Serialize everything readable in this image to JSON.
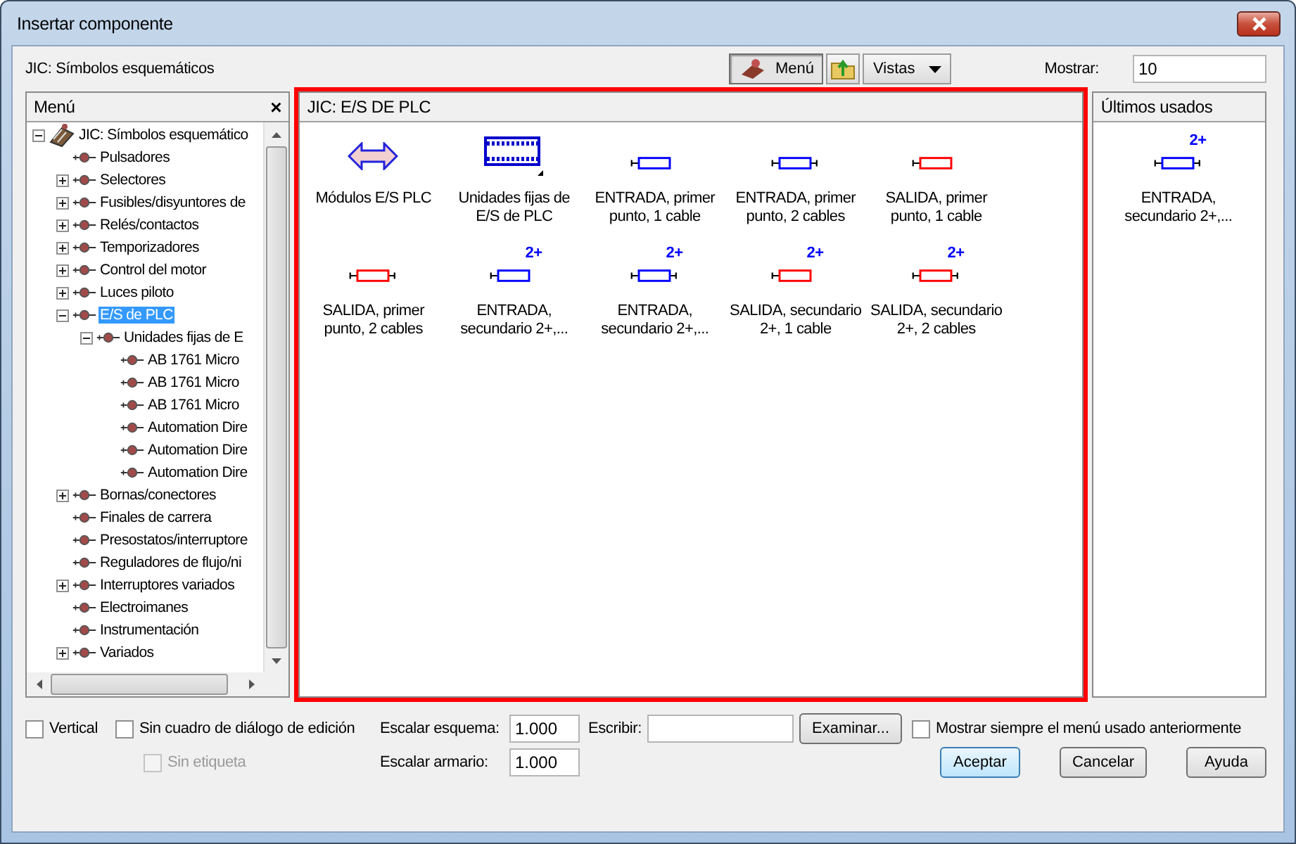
{
  "window": {
    "title": "Insertar componente"
  },
  "library_label": "JIC: Símbolos esquemáticos",
  "toolbar": [
    {
      "label": "Menú",
      "kind": "toggle",
      "pressed": true
    },
    {
      "kind": "folder-up"
    },
    {
      "label": "Vistas",
      "kind": "dropdown"
    }
  ],
  "show": {
    "label": "Mostrar:",
    "value": "10"
  },
  "menu_panel": {
    "title": "Menú",
    "close": "×",
    "tree": [
      {
        "label": "JIC: Símbolos esquemático",
        "kind": "library",
        "expanded": true,
        "selected": false,
        "children": [
          {
            "label": "Pulsadores",
            "selected": false
          },
          {
            "label": "Selectores",
            "expanded": false,
            "selected": false
          },
          {
            "label": "Fusibles/disyuntores de",
            "expanded": false,
            "selected": false
          },
          {
            "label": "Relés/contactos",
            "expanded": false,
            "selected": false
          },
          {
            "label": "Temporizadores",
            "expanded": false,
            "selected": false
          },
          {
            "label": "Control del motor",
            "expanded": false,
            "selected": false
          },
          {
            "label": "Luces piloto",
            "expanded": false,
            "selected": false
          },
          {
            "label": "E/S de PLC",
            "expanded": true,
            "selected": true,
            "children": [
              {
                "label": "Unidades fijas de E",
                "expanded": true,
                "selected": false,
                "children": [
                  {
                    "label": "AB 1761 Micro",
                    "selected": false
                  },
                  {
                    "label": "AB 1761 Micro",
                    "selected": false
                  },
                  {
                    "label": "AB 1761 Micro",
                    "selected": false
                  },
                  {
                    "label": "Automation Dire",
                    "selected": false
                  },
                  {
                    "label": "Automation Dire",
                    "selected": false
                  },
                  {
                    "label": "Automation Dire",
                    "selected": false
                  }
                ]
              }
            ]
          },
          {
            "label": "Bornas/conectores",
            "expanded": false,
            "selected": false
          },
          {
            "label": "Finales de carrera",
            "selected": false
          },
          {
            "label": "Presostatos/interruptore",
            "selected": false
          },
          {
            "label": "Reguladores de flujo/ni",
            "selected": false
          },
          {
            "label": "Interruptores variados",
            "expanded": false,
            "selected": false
          },
          {
            "label": "Electroimanes",
            "selected": false
          },
          {
            "label": "Instrumentación",
            "selected": false
          },
          {
            "label": "Variados",
            "expanded": false,
            "selected": false
          }
        ]
      }
    ]
  },
  "symbols_panel": {
    "title": "JIC: E/S DE PLC",
    "items": [
      {
        "label": "Módulos E/S PLC",
        "kind": "arrow"
      },
      {
        "label": "Unidades fijas de E/S de PLC",
        "kind": "strip"
      },
      {
        "label": "ENTRADA, primer punto, 1 cable",
        "kind": "one-end",
        "color": "#0000ff"
      },
      {
        "label": "ENTRADA, primer punto, 2 cables",
        "kind": "two-end",
        "color": "#0000ff"
      },
      {
        "label": "SALIDA, primer punto, 1 cable",
        "kind": "one-end",
        "color": "#ff0000"
      },
      {
        "label": "SALIDA, primer punto, 2 cables",
        "kind": "two-end",
        "color": "#ff0000"
      },
      {
        "label": "ENTRADA, secundario 2+,...",
        "kind": "one-end",
        "color": "#0000ff",
        "badge": "2+"
      },
      {
        "label": "ENTRADA, secundario 2+,...",
        "kind": "two-end",
        "color": "#0000ff",
        "badge": "2+"
      },
      {
        "label": "SALIDA, secundario 2+, 1 cable",
        "kind": "one-end",
        "color": "#ff0000",
        "badge": "2+"
      },
      {
        "label": "SALIDA, secundario 2+, 2 cables",
        "kind": "two-end",
        "color": "#ff0000",
        "badge": "2+"
      }
    ]
  },
  "recent_panel": {
    "title": "Últimos usados",
    "items": [
      {
        "label": "ENTRADA, secundario 2+,...",
        "kind": "two-end",
        "color": "#0000ff",
        "badge": "2+"
      }
    ]
  },
  "options": {
    "vertical": {
      "label": "Vertical",
      "checked": false
    },
    "no_edit_dialog": {
      "label": "Sin cuadro de diálogo de edición",
      "checked": false
    },
    "no_tag": {
      "label": "Sin etiqueta",
      "checked": false,
      "disabled": true
    },
    "scale_schematic": {
      "label": "Escalar esquema:",
      "value": "1.000"
    },
    "scale_panel": {
      "label": "Escalar armario:",
      "value": "1.000"
    },
    "write": {
      "label": "Escribir:"
    },
    "browse": "Examinar...",
    "remember_menu": {
      "label": "Mostrar siempre el menú usado anteriormente",
      "checked": false
    }
  },
  "buttons": [
    {
      "label": "Aceptar",
      "default": true
    },
    {
      "label": "Cancelar",
      "default": false
    },
    {
      "label": "Ayuda",
      "default": false
    }
  ]
}
